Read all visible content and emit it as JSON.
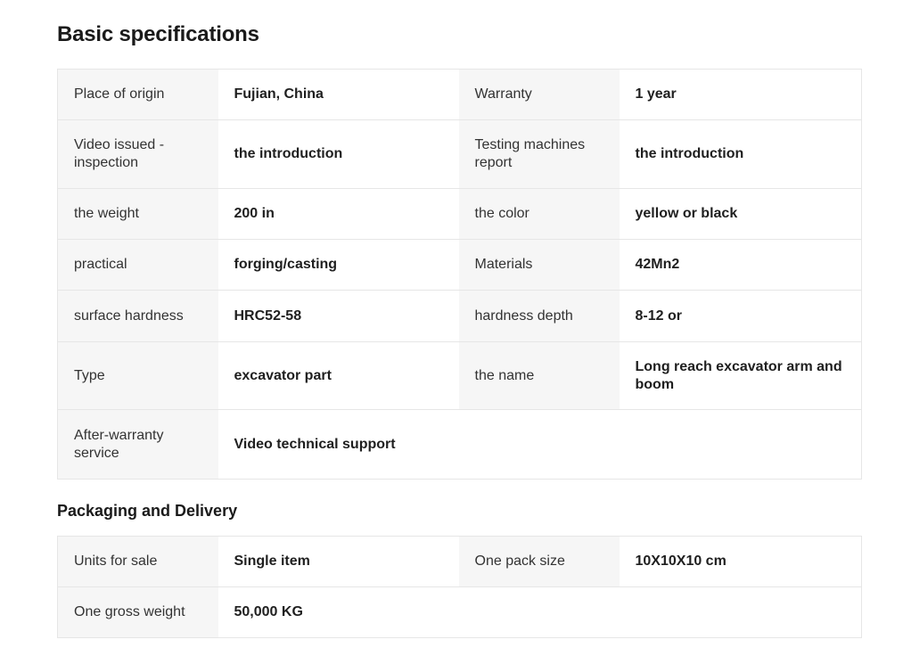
{
  "basic": {
    "title": "Basic specifications",
    "rows": [
      {
        "l1": "Place of origin",
        "v1": "Fujian, China",
        "l2": "Warranty",
        "v2": "1 year"
      },
      {
        "l1": "Video issued - inspection",
        "v1": "the introduction",
        "l2": "Testing machines report",
        "v2": "the introduction"
      },
      {
        "l1": "the weight",
        "v1": "200 in",
        "l2": "the color",
        "v2": "yellow or black"
      },
      {
        "l1": "practical",
        "v1": "forging/casting",
        "l2": "Materials",
        "v2": "42Mn2"
      },
      {
        "l1": "surface hardness",
        "v1": "HRC52-58",
        "l2": "hardness depth",
        "v2": "8-12 or"
      },
      {
        "l1": "Type",
        "v1": "excavator part",
        "l2": "the name",
        "v2": "Long reach excavator arm and boom"
      },
      {
        "l1": "After-warranty service",
        "v1": "Video technical support",
        "l2": "",
        "v2": ""
      }
    ]
  },
  "packaging": {
    "title": "Packaging and Delivery",
    "rows": [
      {
        "l1": "Units for sale",
        "v1": "Single item",
        "l2": "One pack size",
        "v2": "10X10X10 cm"
      },
      {
        "l1": "One gross weight",
        "v1": "50,000 KG",
        "l2": "",
        "v2": ""
      }
    ]
  }
}
